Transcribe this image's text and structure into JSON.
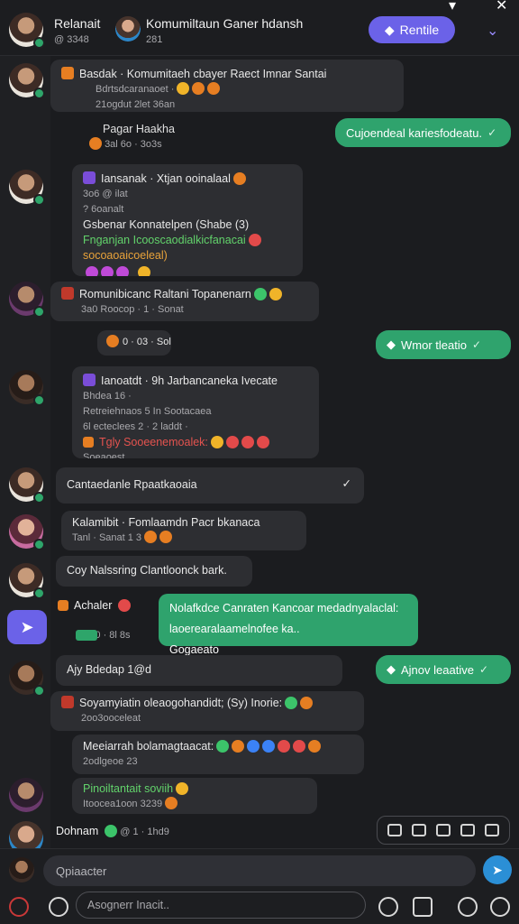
{
  "window": {
    "min_icon": "minimize-icon",
    "close_label": "✕"
  },
  "header": {
    "name": "Relanait",
    "sub": "@ 3348",
    "group_name": "Komumiltaun Ganer hdansh",
    "group_sub": "281",
    "action_label": "Rentile"
  },
  "messages": [
    {
      "title": "Basdak · Komumitaeh cbayer Raect Imnar Santai",
      "l2": "Bdrtsdcaranaoet ·",
      "l3": "21ogdut 2let 36an"
    },
    {
      "reply_title": "Pagar Haakha",
      "reply_sub": "3al 6o · 3o3s"
    },
    {
      "title": "Iansanak · Xtjan ooinalaal",
      "l2": "3o6 @ ilat",
      "l3": "? 6oanalt",
      "l4": "Gsbenar Konnatelpen (Shabe (3)",
      "l5": "Fnganjan Icooscaodialkicfanacai",
      "l6": "socoaoaicoeleal)"
    },
    {
      "title": "Romunibicanc Raltani Topanenarn",
      "sub": "3a0 Roocop · 1 · Sonat"
    },
    {
      "title": "Ianoatdt · 9h Jarbancaneka Ivecate",
      "l2": "Bhdea 16 ·",
      "l3": "Retreiehnaos 5 In Sootacaea",
      "l4": "6l ecteclees 2 · 2 laddt ·",
      "l5": "Tgly Sooeenemoalek:",
      "l6": "Soeaoest"
    },
    {
      "title": "Cantaedanle Rpaatkaoaia"
    },
    {
      "title": "Kalamibit · Fomlaamdn Pacr bkanaca",
      "sub": "Tanl · Sanat 1 3"
    },
    {
      "title": "Coy Nalssring Clantloonck bark."
    },
    {
      "title": "Achaler",
      "sub": "09 30 · 8l 8s"
    },
    {
      "title": "Ajy Bdedap 1@d"
    },
    {
      "title": "Soyamyiatin oleaogohandidt; (Sy) Inorie:",
      "sub": "2oo3ooceleat"
    },
    {
      "title": "Meeiarrah bolamagtaacat:",
      "sub": "2odlgeoe 23"
    },
    {
      "title": "Pinoiltantait soviih",
      "sub": "Itoocea1oon 3239"
    },
    {
      "title": "Dohnam",
      "sub": "@ 1 · 1hd9"
    }
  ],
  "right": [
    {
      "label": "Cujoendeal kariesfodeatu."
    },
    {
      "label": "Wmor tleatio"
    },
    {
      "label": "Ajnov leaative"
    }
  ],
  "green_block": {
    "l1": "Nolafkdce Canraten Kancoar medadnyalaclal:",
    "l2": "laoerearalaamelnofee ka..",
    "l3": "Gogaeato"
  },
  "chip_small": {
    "label": "0 · 03 · Sol9"
  },
  "composer": {
    "placeholder": "Qpiaacter"
  },
  "search": {
    "placeholder": "Asognerr Inacit.."
  },
  "colors": {
    "accent": "#6b62e8",
    "green": "#2fa36d",
    "bg": "#1b1c1f"
  }
}
